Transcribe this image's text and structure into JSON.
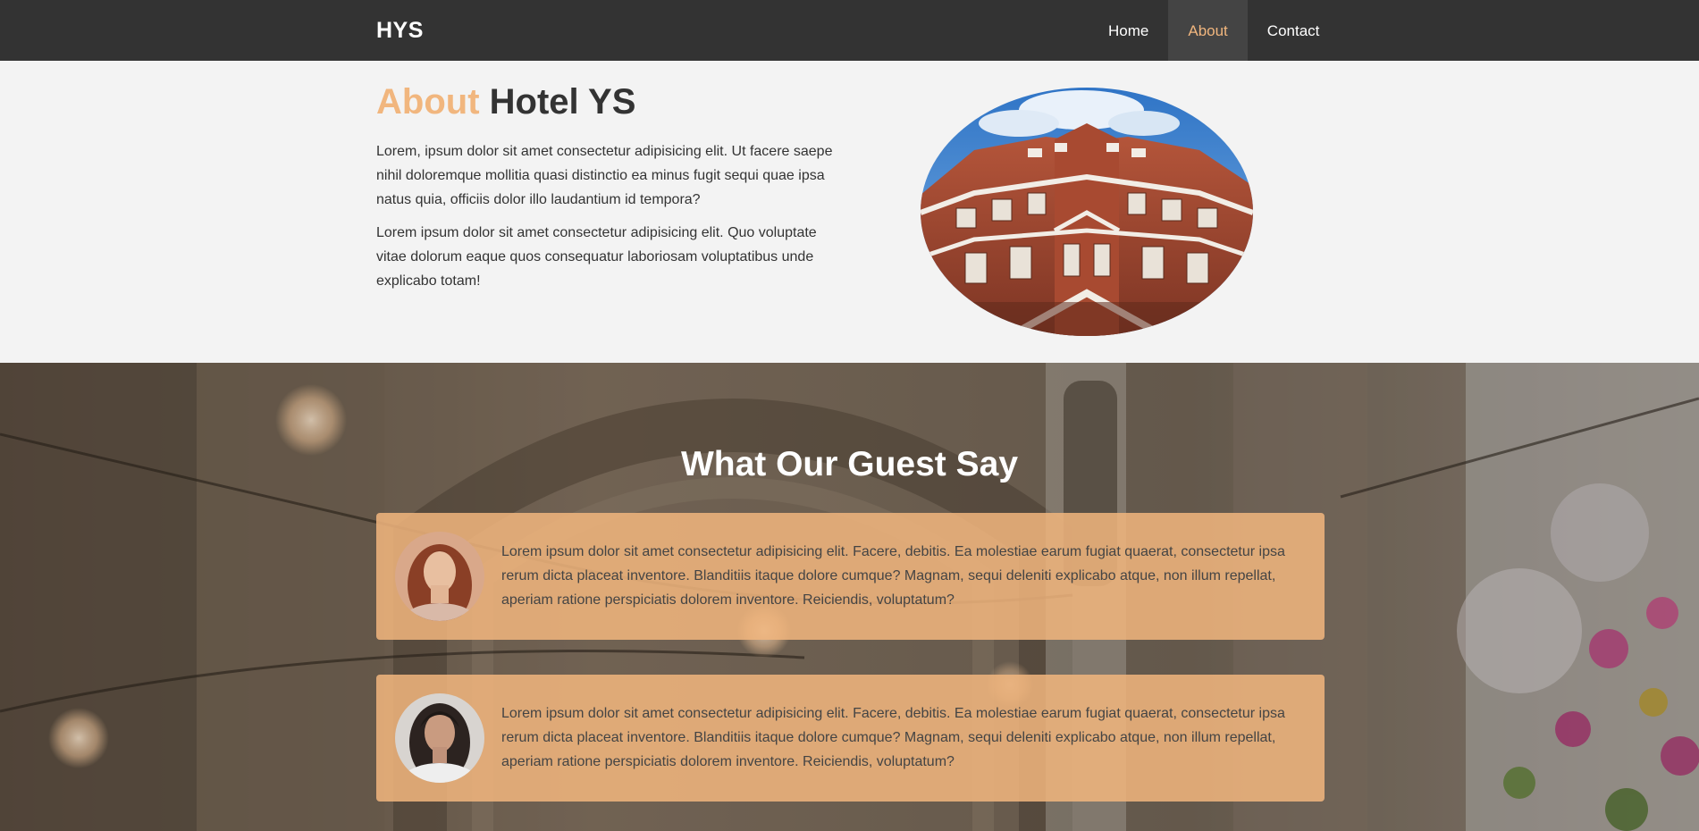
{
  "nav": {
    "brand": "HYS",
    "links": [
      {
        "label": "Home",
        "active": false
      },
      {
        "label": "About",
        "active": true
      },
      {
        "label": "Contact",
        "active": false
      }
    ]
  },
  "about": {
    "title_accent": "About",
    "title_rest": "Hotel YS",
    "paragraphs": [
      "Lorem, ipsum dolor sit amet consectetur adipisicing elit. Ut facere saepe nihil doloremque mollitia quasi distinctio ea minus fugit sequi quae ipsa natus quia, officiis dolor illo laudantium id tempora?",
      "Lorem ipsum dolor sit amet consectetur adipisicing elit. Quo voluptate vitae dolorum eaque quos consequatur laboriosam voluptatibus unde explicabo totam!"
    ]
  },
  "testimonials": {
    "title": "What Our Guest Say",
    "items": [
      {
        "text": "Lorem ipsum dolor sit amet consectetur adipisicing elit. Facere, debitis. Ea molestiae earum fugiat quaerat, consectetur ipsa rerum dicta placeat inventore. Blanditiis itaque dolore cumque? Magnam, sequi deleniti explicabo atque, non illum repellat, aperiam ratione perspiciatis dolorem inventore. Reiciendis, voluptatum?"
      },
      {
        "text": "Lorem ipsum dolor sit amet consectetur adipisicing elit. Facere, debitis. Ea molestiae earum fugiat quaerat, consectetur ipsa rerum dicta placeat inventore. Blanditiis itaque dolore cumque? Magnam, sequi deleniti explicabo atque, non illum repellat, aperiam ratione perspiciatis dolorem inventore. Reiciendis, voluptatum?"
      }
    ]
  },
  "colors": {
    "navbar": "#333333",
    "accent": "#f1b67e",
    "page_bg": "#f3f3f3",
    "card_bg": "#f1b67e"
  }
}
